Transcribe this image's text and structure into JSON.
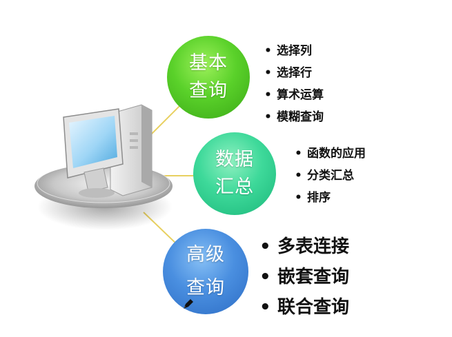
{
  "diagram": {
    "center_icon": "computer-icon",
    "nodes": [
      {
        "id": "basic-query",
        "label_lines": [
          "基本",
          "查询"
        ],
        "color": "#5ad12a",
        "items": [
          "选择列",
          "选择行",
          "算术运算",
          "模糊查询"
        ]
      },
      {
        "id": "data-summary",
        "label_lines": [
          "数据",
          "汇总"
        ],
        "color": "#3ed99a",
        "items": [
          "函数的应用",
          "分类汇总",
          "排序"
        ]
      },
      {
        "id": "advanced-query",
        "label_lines": [
          "高级",
          "查询"
        ],
        "color": "#4a8fe0",
        "items": [
          "多表连接",
          "嵌套查询",
          "联合查询"
        ]
      }
    ],
    "connector_color": "#e8d060"
  }
}
